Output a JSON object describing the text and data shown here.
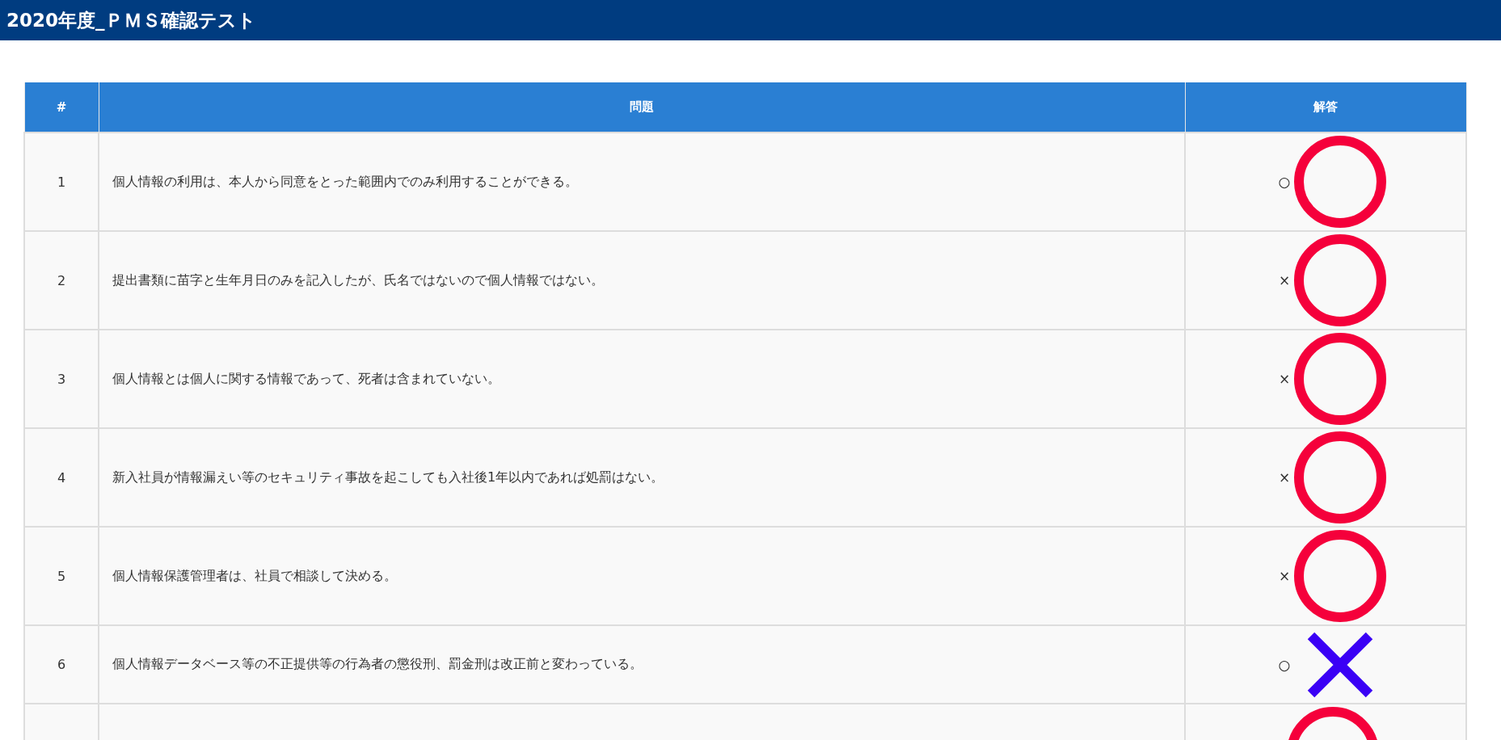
{
  "title": "2020年度_ＰＭＳ確認テスト",
  "table": {
    "columns": [
      "#",
      "問題",
      "解答"
    ],
    "rows": [
      {
        "number": "1",
        "question": "個人情報の利用は、本人から同意をとった範囲内でのみ利用することができる。",
        "answer": "○",
        "kind": "circle"
      },
      {
        "number": "2",
        "question": "提出書類に苗字と生年月日のみを記入したが、氏名ではないので個人情報ではない。",
        "answer": "×",
        "kind": "circle"
      },
      {
        "number": "3",
        "question": "個人情報とは個人に関する情報であって、死者は含まれていない。",
        "answer": "×",
        "kind": "circle"
      },
      {
        "number": "4",
        "question": "新入社員が情報漏えい等のセキュリティ事故を起こしても入社後1年以内であれば処罰はない。",
        "answer": "×",
        "kind": "circle"
      },
      {
        "number": "5",
        "question": "個人情報保護管理者は、社員で相談して決める。",
        "answer": "×",
        "kind": "circle"
      },
      {
        "number": "6",
        "question": "個人情報データベース等の不正提供等の行為者の懲役刑、罰金刑は改正前と変わっている。",
        "answer": "○",
        "kind": "cross"
      },
      {
        "kind": "circle"
      }
    ]
  }
}
